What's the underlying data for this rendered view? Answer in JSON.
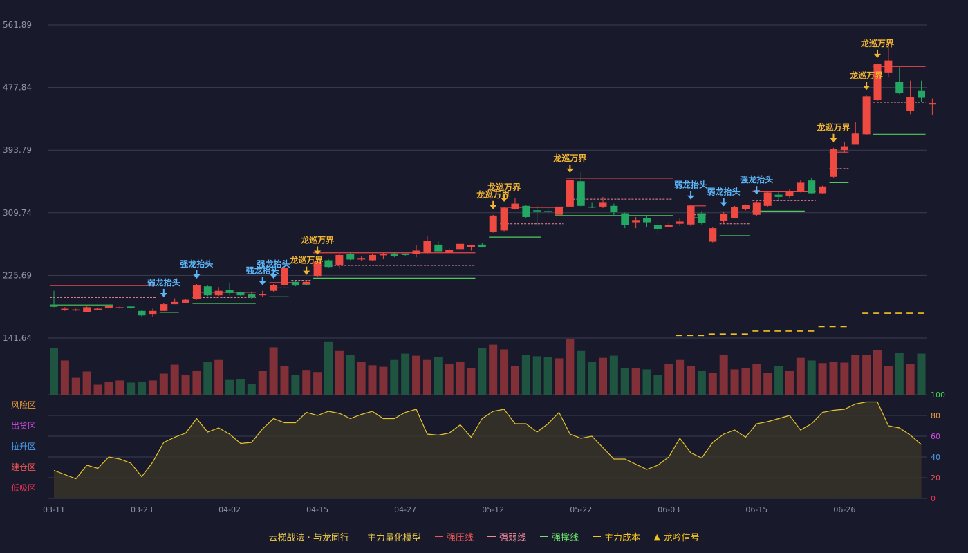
{
  "chart_data": {
    "type": "candlestick",
    "price_axis": {
      "ticks": [
        "561.89",
        "477.84",
        "393.79",
        "309.74",
        "225.69",
        "141.64"
      ],
      "min": 141.64,
      "max": 561.89
    },
    "x_ticks": [
      "03-11",
      "03-23",
      "04-02",
      "04-15",
      "04-27",
      "05-12",
      "05-22",
      "06-03",
      "06-15",
      "06-26"
    ],
    "x_tick_index": [
      0,
      8,
      16,
      24,
      32,
      40,
      48,
      56,
      64,
      72
    ],
    "candles": [
      [
        185,
        184,
        205,
        183
      ],
      [
        181,
        181,
        183,
        178
      ],
      [
        180,
        180,
        181,
        178
      ],
      [
        176,
        183,
        184,
        176
      ],
      [
        180,
        181,
        182,
        180
      ],
      [
        182,
        185,
        186,
        181
      ],
      [
        183,
        183,
        185,
        181
      ],
      [
        184,
        182,
        185,
        181
      ],
      [
        178,
        172,
        179,
        170
      ],
      [
        174,
        178,
        181,
        170
      ],
      [
        178,
        187,
        189,
        178
      ],
      [
        187,
        190,
        195,
        187
      ],
      [
        189,
        193,
        194,
        188
      ],
      [
        194,
        213,
        214,
        193
      ],
      [
        211,
        199,
        212,
        198
      ],
      [
        199,
        205,
        210,
        198
      ],
      [
        206,
        202,
        216,
        199
      ],
      [
        203,
        199,
        204,
        198
      ],
      [
        201,
        196,
        204,
        194
      ],
      [
        199,
        201,
        205,
        197
      ],
      [
        205,
        213,
        214,
        204
      ],
      [
        213,
        236,
        237,
        212
      ],
      [
        217,
        212,
        218,
        211
      ],
      [
        214,
        217,
        219,
        212
      ],
      [
        225,
        244,
        246,
        224
      ],
      [
        246,
        237,
        248,
        236
      ],
      [
        240,
        253,
        254,
        235
      ],
      [
        254,
        247,
        256,
        246
      ],
      [
        247,
        249,
        251,
        245
      ],
      [
        246,
        253,
        254,
        245
      ],
      [
        253,
        254,
        256,
        248
      ],
      [
        255,
        252,
        257,
        250
      ],
      [
        255,
        253,
        255,
        251
      ],
      [
        254,
        259,
        266,
        250
      ],
      [
        256,
        272,
        279,
        254
      ],
      [
        267,
        258,
        272,
        257
      ],
      [
        256,
        260,
        262,
        256
      ],
      [
        261,
        268,
        270,
        257
      ],
      [
        264,
        266,
        267,
        259
      ],
      [
        267,
        264,
        269,
        263
      ],
      [
        284,
        306,
        307,
        283
      ],
      [
        286,
        316,
        317,
        285
      ],
      [
        315,
        322,
        329,
        314
      ],
      [
        319,
        304,
        320,
        303
      ],
      [
        313,
        312,
        319,
        292
      ],
      [
        312,
        311,
        317,
        307
      ],
      [
        307,
        318,
        321,
        305
      ],
      [
        318,
        354,
        356,
        317
      ],
      [
        352,
        319,
        364,
        318
      ],
      [
        318,
        317,
        324,
        316
      ],
      [
        318,
        324,
        331,
        316
      ],
      [
        319,
        311,
        322,
        305
      ],
      [
        309,
        293,
        310,
        289
      ],
      [
        297,
        300,
        304,
        289
      ],
      [
        303,
        297,
        305,
        291
      ],
      [
        293,
        288,
        298,
        282
      ],
      [
        291,
        293,
        297,
        290
      ],
      [
        295,
        298,
        302,
        292
      ],
      [
        294,
        319,
        320,
        292
      ],
      [
        309,
        296,
        312,
        294
      ],
      [
        271,
        289,
        290,
        270
      ],
      [
        299,
        308,
        311,
        295
      ],
      [
        303,
        317,
        319,
        302
      ],
      [
        315,
        320,
        321,
        313
      ],
      [
        307,
        324,
        327,
        305
      ],
      [
        319,
        337,
        338,
        318
      ],
      [
        334,
        331,
        339,
        325
      ],
      [
        332,
        339,
        341,
        329
      ],
      [
        338,
        350,
        354,
        337
      ],
      [
        353,
        336,
        357,
        335
      ],
      [
        336,
        345,
        346,
        335
      ],
      [
        358,
        395,
        397,
        357
      ],
      [
        394,
        399,
        405,
        390
      ],
      [
        401,
        416,
        432,
        401
      ],
      [
        415,
        466,
        467,
        414
      ],
      [
        461,
        509,
        510,
        460
      ],
      [
        498,
        514,
        534,
        492
      ],
      [
        485,
        470,
        505,
        469
      ],
      [
        446,
        465,
        487,
        442
      ],
      [
        474,
        464,
        487,
        458
      ],
      [
        455,
        457,
        463,
        441
      ]
    ],
    "volume": [
      88,
      65,
      32,
      44,
      19,
      24,
      27,
      23,
      25,
      27,
      40,
      57,
      38,
      46,
      62,
      66,
      28,
      29,
      21,
      45,
      90,
      55,
      38,
      47,
      43,
      100,
      83,
      76,
      63,
      56,
      53,
      66,
      78,
      74,
      66,
      72,
      59,
      62,
      50,
      88,
      95,
      86,
      54,
      75,
      73,
      71,
      69,
      105,
      83,
      63,
      70,
      74,
      51,
      50,
      48,
      38,
      59,
      66,
      55,
      46,
      41,
      75,
      48,
      51,
      58,
      42,
      54,
      45,
      70,
      65,
      60,
      62,
      61,
      75,
      76,
      85,
      55,
      80,
      58,
      78
    ],
    "indicator": {
      "values": [
        27,
        23,
        19,
        32,
        29,
        40,
        38,
        34,
        21,
        35,
        54,
        59,
        63,
        77,
        64,
        68,
        62,
        53,
        54,
        67,
        77,
        73,
        73,
        83,
        80,
        84,
        82,
        77,
        81,
        84,
        77,
        77,
        83,
        86,
        62,
        61,
        63,
        71,
        59,
        77,
        84,
        86,
        72,
        72,
        64,
        72,
        83,
        62,
        58,
        60,
        49,
        38,
        38,
        33,
        28,
        32,
        40,
        58,
        44,
        39,
        54,
        62,
        66,
        59,
        72,
        74,
        77,
        80,
        66,
        72,
        83,
        85,
        86,
        91,
        93,
        93,
        70,
        68,
        61,
        52
      ],
      "zone_labels": [
        "风险区",
        "出货区",
        "拉升区",
        "建仓区",
        "低吸区"
      ],
      "zone_colors": [
        "#e89a3c",
        "#d04adf",
        "#4a9ef0",
        "#ee5555",
        "#ee3355"
      ],
      "axis_ticks": [
        "100",
        "80",
        "60",
        "40",
        "20",
        "0"
      ],
      "axis_colors": [
        "#3fdc50",
        "#e89a3c",
        "#d04adf",
        "#4a9ef0",
        "#ee5555",
        "#ee3355"
      ]
    },
    "signals": [
      {
        "index": 10,
        "label": "弱龙抬头",
        "type": "weak"
      },
      {
        "index": 13,
        "label": "强龙抬头",
        "type": "strong"
      },
      {
        "index": 19,
        "label": "强龙抬头",
        "type": "strong"
      },
      {
        "index": 20,
        "label": "强龙抬头",
        "type": "strong"
      },
      {
        "index": 23,
        "label": "龙巡万界",
        "type": "dragon"
      },
      {
        "index": 24,
        "label": "龙巡万界",
        "type": "dragon"
      },
      {
        "index": 40,
        "label": "龙巡万界",
        "type": "dragon"
      },
      {
        "index": 41,
        "label": "龙巡万界",
        "type": "dragon"
      },
      {
        "index": 47,
        "label": "龙巡万界",
        "type": "dragon"
      },
      {
        "index": 58,
        "label": "弱龙抬头",
        "type": "weak"
      },
      {
        "index": 61,
        "label": "弱龙抬头",
        "type": "weak"
      },
      {
        "index": 64,
        "label": "强龙抬头",
        "type": "strong"
      },
      {
        "index": 71,
        "label": "龙巡万界",
        "type": "dragon"
      },
      {
        "index": 74,
        "label": "龙巡万界",
        "type": "dragon"
      },
      {
        "index": 75,
        "label": "龙巡万界",
        "type": "dragon"
      }
    ],
    "pressure_lines": [
      {
        "from": 0,
        "to": 9,
        "value": 212
      },
      {
        "from": 13,
        "to": 18,
        "value": 203
      },
      {
        "from": 20,
        "to": 22,
        "value": 216
      },
      {
        "from": 24,
        "to": 38,
        "value": 256
      },
      {
        "from": 41,
        "to": 46,
        "value": 317
      },
      {
        "from": 47,
        "to": 56,
        "value": 356
      },
      {
        "from": 58,
        "to": 59,
        "value": 319
      },
      {
        "from": 61,
        "to": 63,
        "value": 311
      },
      {
        "from": 64,
        "to": 69,
        "value": 338
      },
      {
        "from": 71,
        "to": 72,
        "value": 391
      },
      {
        "from": 75,
        "to": 79,
        "value": 506
      }
    ],
    "weak_lines": [
      {
        "from": 0,
        "to": 9,
        "value": 196
      },
      {
        "from": 10,
        "to": 11,
        "value": 182
      },
      {
        "from": 13,
        "to": 18,
        "value": 196
      },
      {
        "from": 20,
        "to": 21,
        "value": 209
      },
      {
        "from": 22,
        "to": 23,
        "value": 219
      },
      {
        "from": 24,
        "to": 38,
        "value": 239
      },
      {
        "from": 41,
        "to": 46,
        "value": 295
      },
      {
        "from": 47,
        "to": 56,
        "value": 328
      },
      {
        "from": 58,
        "to": 59,
        "value": 307
      },
      {
        "from": 61,
        "to": 63,
        "value": 295
      },
      {
        "from": 64,
        "to": 69,
        "value": 326
      },
      {
        "from": 71,
        "to": 72,
        "value": 369
      },
      {
        "from": 75,
        "to": 79,
        "value": 458
      }
    ],
    "support_lines": [
      {
        "from": 0,
        "to": 5,
        "value": 186
      },
      {
        "from": 10,
        "to": 11,
        "value": 176
      },
      {
        "from": 13,
        "to": 18,
        "value": 188
      },
      {
        "from": 20,
        "to": 21,
        "value": 197
      },
      {
        "from": 23,
        "to": 23,
        "value": 214
      },
      {
        "from": 24,
        "to": 38,
        "value": 222
      },
      {
        "from": 40,
        "to": 44,
        "value": 277
      },
      {
        "from": 46,
        "to": 56,
        "value": 306
      },
      {
        "from": 58,
        "to": 59,
        "value": 303
      },
      {
        "from": 61,
        "to": 63,
        "value": 279
      },
      {
        "from": 64,
        "to": 68,
        "value": 312
      },
      {
        "from": 71,
        "to": 72,
        "value": 350
      },
      {
        "from": 75,
        "to": 79,
        "value": 415
      }
    ],
    "cost_lines": [
      {
        "from": 57,
        "to": 59,
        "value": 145
      },
      {
        "from": 60,
        "to": 63,
        "value": 147
      },
      {
        "from": 64,
        "to": 69,
        "value": 151
      },
      {
        "from": 70,
        "to": 72,
        "value": 157
      },
      {
        "from": 74,
        "to": 79,
        "value": 175
      }
    ]
  },
  "colors": {
    "up": "#ef4a42",
    "down": "#22a862",
    "vol_up": "#823037",
    "vol_down": "#1f5441",
    "pressure": "#e8474d",
    "weak": "#f08a9a",
    "support": "#4ecb5c",
    "cost": "#f4c21e",
    "strong_signal": "#5cb6f8",
    "dragon_signal": "#f3b633",
    "grid": "#3a3d52",
    "axis_text": "#8e93a8",
    "indicator_line": "#e8c52e"
  },
  "legend": {
    "title": "云梯战法 · 与龙同行——主力量化模型",
    "items": [
      {
        "label": "强压线",
        "kind": "solid",
        "color": "#ef5656"
      },
      {
        "label": "强弱线",
        "kind": "dashed",
        "color": "#f08a9a"
      },
      {
        "label": "强撑线",
        "kind": "solid",
        "color": "#6ee36a"
      },
      {
        "label": "主力成本",
        "kind": "dashed",
        "color": "#f4c21e"
      },
      {
        "label": "龙吟信号",
        "kind": "triangle",
        "color": "#f4c21e"
      }
    ]
  }
}
